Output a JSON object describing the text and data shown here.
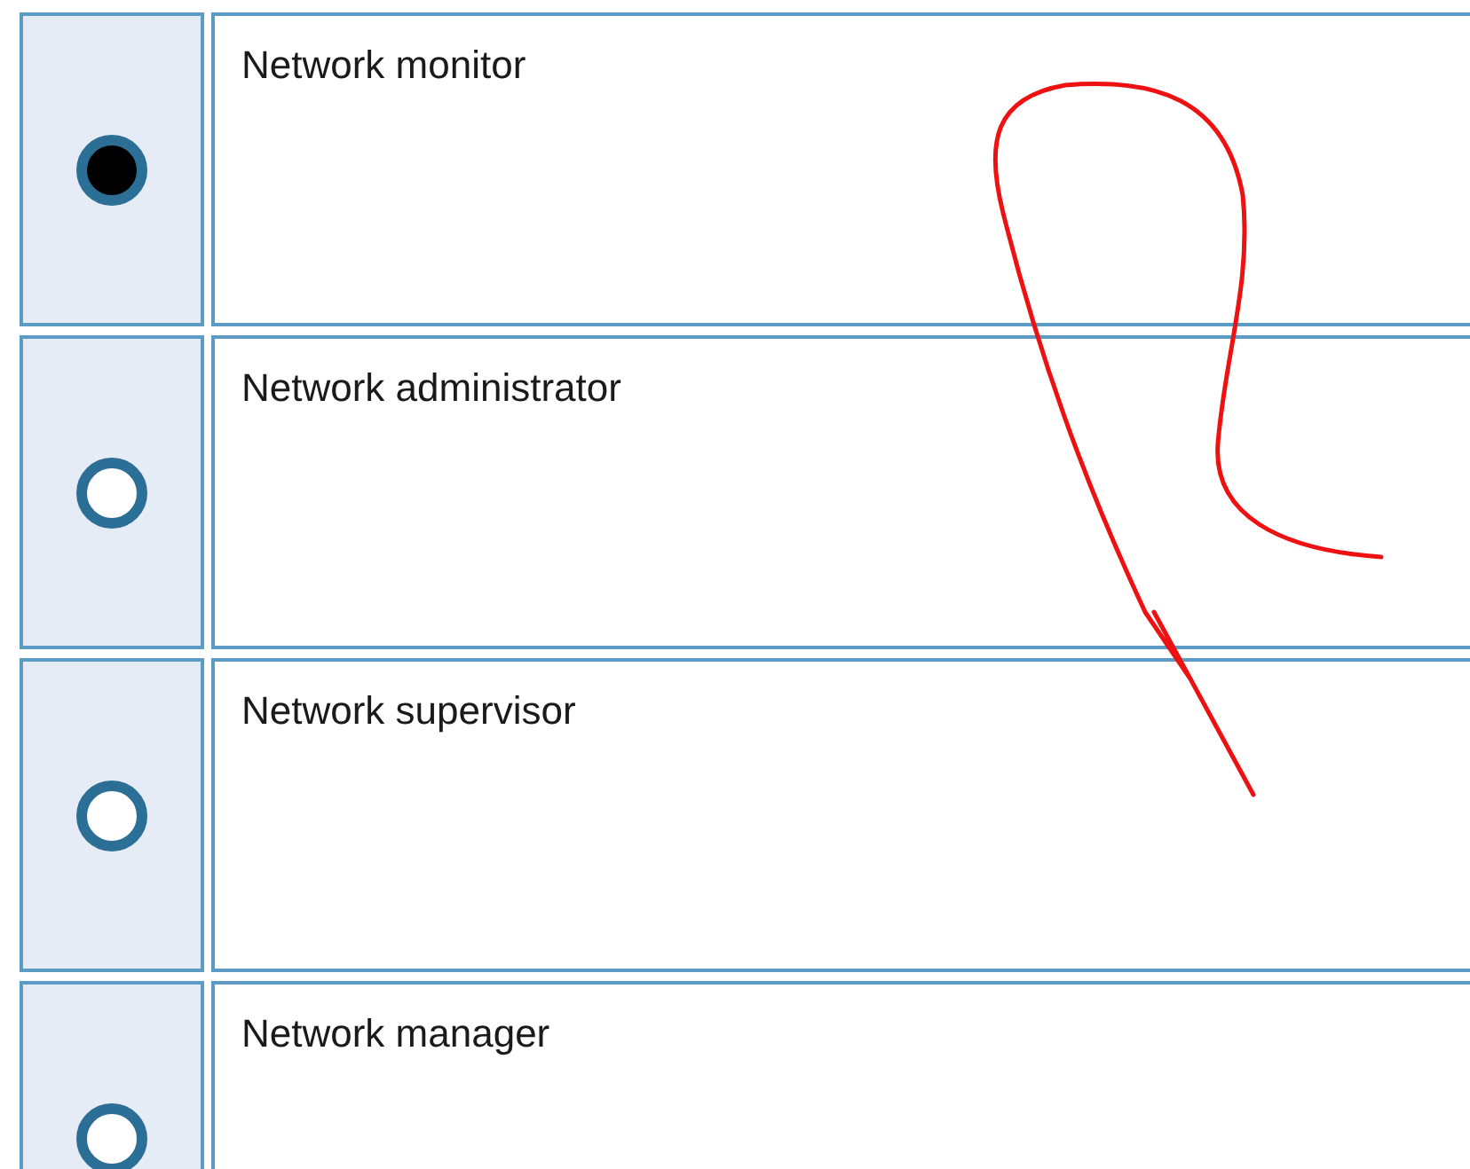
{
  "options": [
    {
      "label": "Network monitor",
      "selected": true
    },
    {
      "label": "Network administrator",
      "selected": false
    },
    {
      "label": "Network supervisor",
      "selected": false
    },
    {
      "label": "Network manager",
      "selected": false
    }
  ]
}
